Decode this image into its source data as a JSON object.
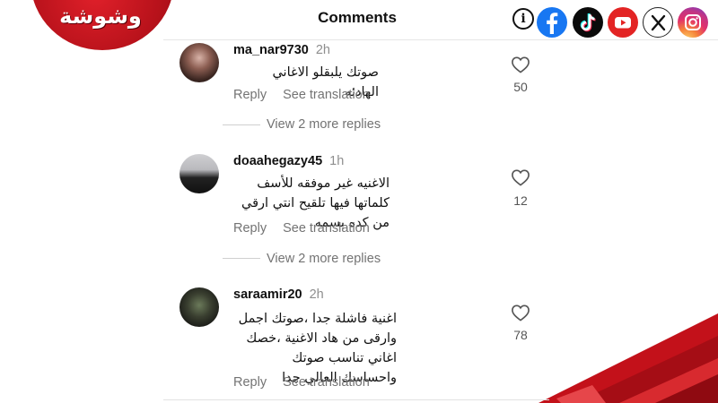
{
  "brand": {
    "logo_text": "وشوشة",
    "accent": "#d4111b"
  },
  "header": {
    "title": "Comments"
  },
  "social": [
    "info-icon",
    "facebook-icon",
    "tiktok-icon",
    "youtube-icon",
    "x-icon",
    "instagram-icon"
  ],
  "comments": [
    {
      "username": "ma_nar9730",
      "time": "2h",
      "text": "صوتك يلبقلو الاغاني الهادئه",
      "likes": "50",
      "reply": "Reply",
      "translate": "See translation"
    },
    {
      "username": "doaahegazy45",
      "time": "1h",
      "text": "الاغنيه غير موفقه للأسف كلماتها فيها تلقيح انتي ارقي من كده بسمه",
      "likes": "12",
      "reply": "Reply",
      "translate": "See translation"
    },
    {
      "username": "saraamir20",
      "time": "2h",
      "text": "اغنية فاشلة جدا ،صوتك اجمل وارقى من هاد الاغنية ،خصك اغاني تناسب صوتك واحساسك العالي جدا",
      "likes": "78",
      "reply": "Reply",
      "translate": "See translation"
    }
  ],
  "more_replies": [
    "View 2 more replies",
    "View 2 more replies"
  ]
}
